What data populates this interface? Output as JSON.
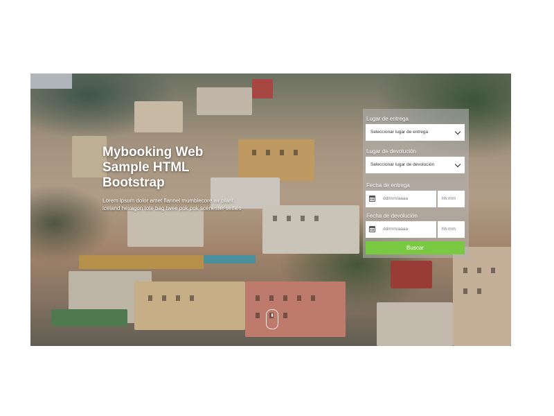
{
  "hero": {
    "title_line1": "Mybooking Web",
    "title_line2": "Sample HTML",
    "title_line3": "Bootstrap",
    "description": "Lorem ipsum dolor amet flannel mumblecore air plant iceland hexagon tote bag twee pok pok scenester selfies"
  },
  "form": {
    "pickup_place_label": "Lugar de entrega",
    "pickup_place_value": "Seleccionar lugar de entrega",
    "return_place_label": "Lugar de devolución",
    "return_place_value": "Seleccionar lugar de devolución",
    "pickup_date_label": "Fecha de entrega",
    "pickup_date_placeholder": "dd/mm/aaaa",
    "pickup_time_placeholder": "hh:mm",
    "return_date_label": "Fecha de devolución",
    "return_date_placeholder": "dd/mm/aaaa",
    "return_time_placeholder": "hh:mm",
    "search_button": "Buscar"
  },
  "colors": {
    "accent": "#7ac943",
    "white": "#ffffff"
  },
  "icons": [
    "chevron-down-icon",
    "calendar-icon",
    "mouse-scroll-icon"
  ]
}
